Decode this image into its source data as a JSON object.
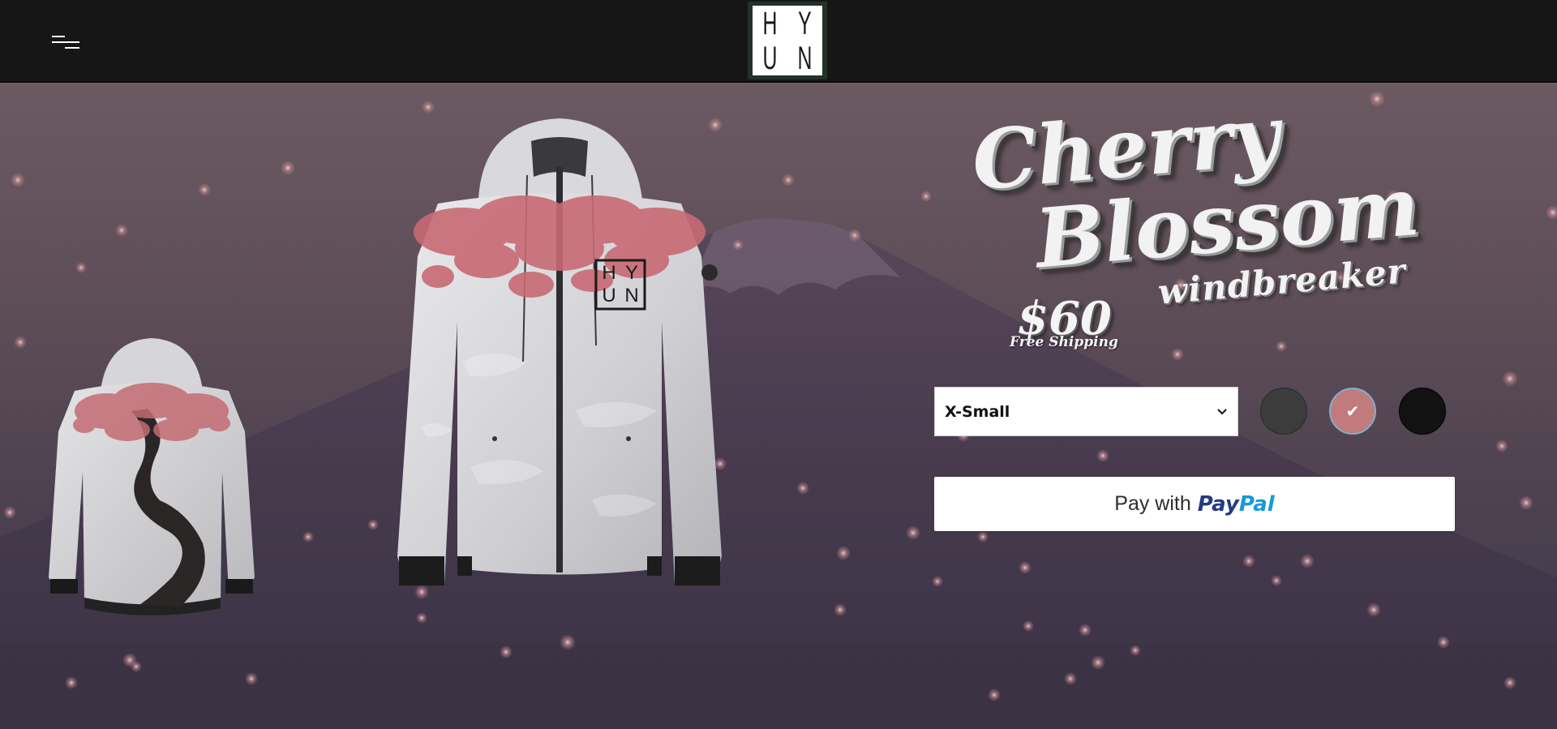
{
  "header": {
    "menu_icon": "hamburger-menu-icon",
    "logo": {
      "letters": [
        "H",
        "Y",
        "U",
        "N"
      ]
    }
  },
  "product": {
    "title_line1": "Cherry",
    "title_line2": "Blossom",
    "title_line3": "windbreaker",
    "price": "$60",
    "shipping": "Free Shipping",
    "front_logo_letters": [
      "H",
      "Y",
      "U",
      "N"
    ]
  },
  "size_select": {
    "selected": "X-Small"
  },
  "colors": {
    "swatches": [
      {
        "name": "charcoal",
        "hex": "#3c3c3c",
        "selected": false
      },
      {
        "name": "pink",
        "hex": "#c27b7d",
        "selected": true
      },
      {
        "name": "black",
        "hex": "#121212",
        "selected": false
      }
    ],
    "selected_check": "✔",
    "accent_paypal_dark": "#253b80",
    "accent_paypal_light": "#179bd7"
  },
  "paypal": {
    "pay_with": "Pay with",
    "brand_pay": "Pay",
    "brand_pal": "Pal"
  }
}
